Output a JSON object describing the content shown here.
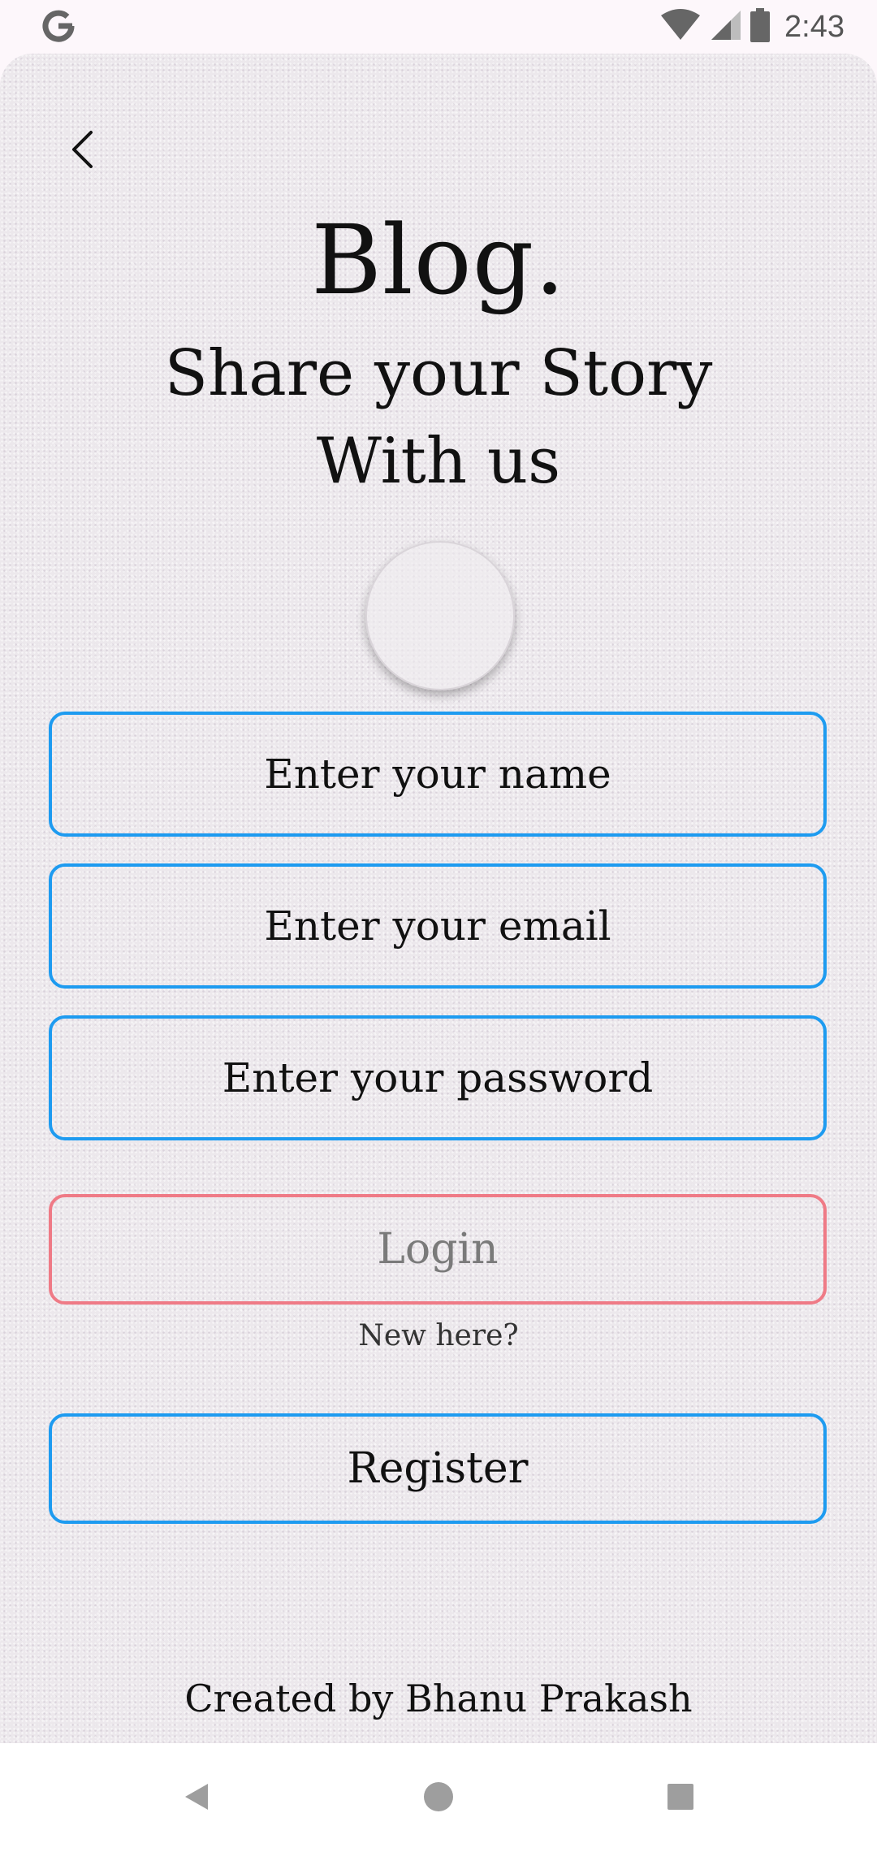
{
  "status_bar": {
    "time": "2:43",
    "icons": [
      "google-g-icon",
      "wifi-icon",
      "cell-signal-icon",
      "battery-icon"
    ]
  },
  "header": {
    "back_icon": "chevron-left-icon",
    "title": "Blog.",
    "tagline_line1": "Share your Story",
    "tagline_line2": "With us"
  },
  "form": {
    "avatar_icon": "profile-picture-placeholder",
    "name_placeholder": "Enter your name",
    "name_value": "",
    "email_placeholder": "Enter your email",
    "email_value": "",
    "password_placeholder": "Enter your password",
    "password_value": "",
    "login_label": "Login",
    "new_here_text": "New here?",
    "register_label": "Register"
  },
  "footer": {
    "credits": "Created by Bhanu Prakash"
  },
  "nav_bar": {
    "icons": [
      "nav-back-icon",
      "nav-home-icon",
      "nav-recents-icon"
    ]
  },
  "colors": {
    "field_border": "#1e9bf0",
    "login_border": "#ef7a86",
    "login_text": "#7a7a7a",
    "text": "#111111",
    "status_bar_bg": "#fdf7fb"
  }
}
